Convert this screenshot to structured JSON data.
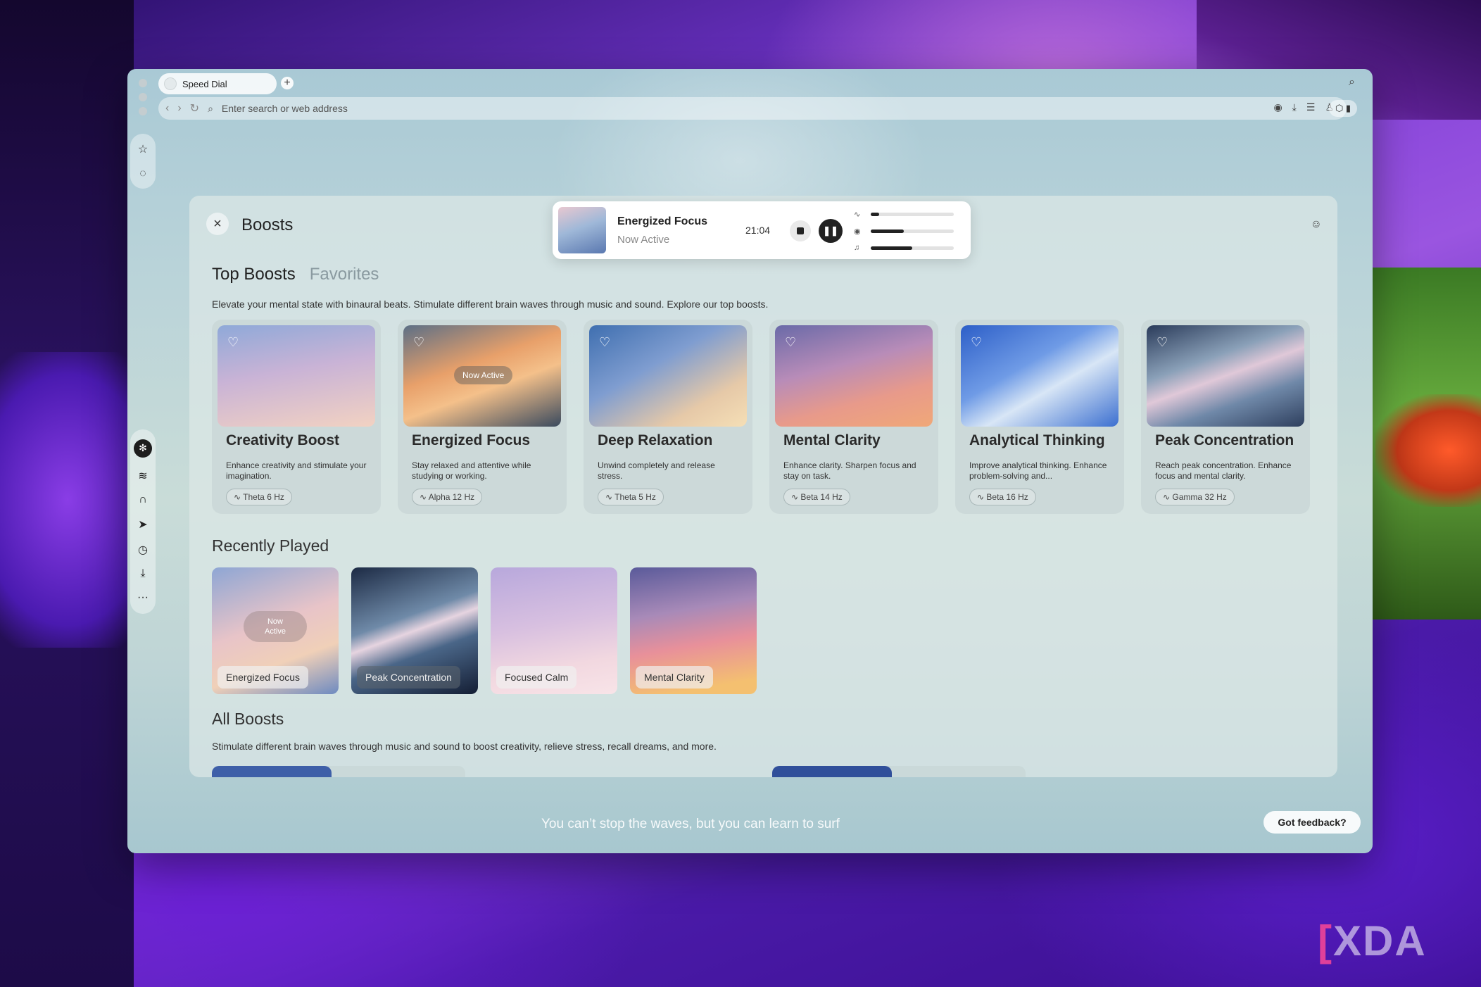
{
  "browser": {
    "tab_title": "Speed Dial",
    "new_tab_icon": "+",
    "address_placeholder": "Enter search or web address"
  },
  "sidebar": {
    "top_items": [
      "speed-dial-icon",
      "aria-icon"
    ],
    "bottom_items": [
      "boosts-icon",
      "layers-icon",
      "headphones-icon",
      "send-icon",
      "history-icon",
      "download-icon",
      "more-icon"
    ]
  },
  "panel": {
    "title": "Boosts",
    "player": {
      "title": "Energized Focus",
      "status": "Now Active",
      "time": "21:04",
      "levels": [
        0.1,
        0.4,
        0.5
      ]
    },
    "tabs": [
      "Top Boosts",
      "Favorites"
    ],
    "description": "Elevate your mental state with binaural beats. Stimulate different brain waves through music and sound. Explore our top boosts.",
    "top_boosts": [
      {
        "title": "Creativity Boost",
        "desc": "Enhance creativity and stimulate your imagination.",
        "freq": "Theta 6 Hz",
        "badge": ""
      },
      {
        "title": "Energized Focus",
        "desc": "Stay relaxed and attentive while studying or working.",
        "freq": "Alpha 12 Hz",
        "badge": "Now Active"
      },
      {
        "title": "Deep Relaxation",
        "desc": "Unwind completely and release stress.",
        "freq": "Theta 5 Hz",
        "badge": ""
      },
      {
        "title": "Mental Clarity",
        "desc": "Enhance clarity. Sharpen focus and stay on task.",
        "freq": "Beta 14 Hz",
        "badge": ""
      },
      {
        "title": "Analytical Thinking",
        "desc": "Improve analytical thinking. Enhance problem-solving and...",
        "freq": "Beta 16 Hz",
        "badge": ""
      },
      {
        "title": "Peak Concentration",
        "desc": "Reach peak concentration. Enhance focus and mental clarity.",
        "freq": "Gamma 32 Hz",
        "badge": ""
      }
    ],
    "recently_played_title": "Recently Played",
    "recently_played": [
      {
        "label": "Energized Focus",
        "badge": "Now\nActive"
      },
      {
        "label": "Peak Concentration",
        "badge": ""
      },
      {
        "label": "Focused Calm",
        "badge": ""
      },
      {
        "label": "Mental Clarity",
        "badge": ""
      }
    ],
    "all_boosts_title": "All Boosts",
    "all_boosts_desc": "Stimulate different brain waves through music and sound to boost creativity, relieve stress, recall dreams, and more."
  },
  "footer": {
    "quote": "You can’t stop the waves, but you can learn to surf",
    "feedback": "Got feedback?"
  },
  "watermark": "XDA"
}
